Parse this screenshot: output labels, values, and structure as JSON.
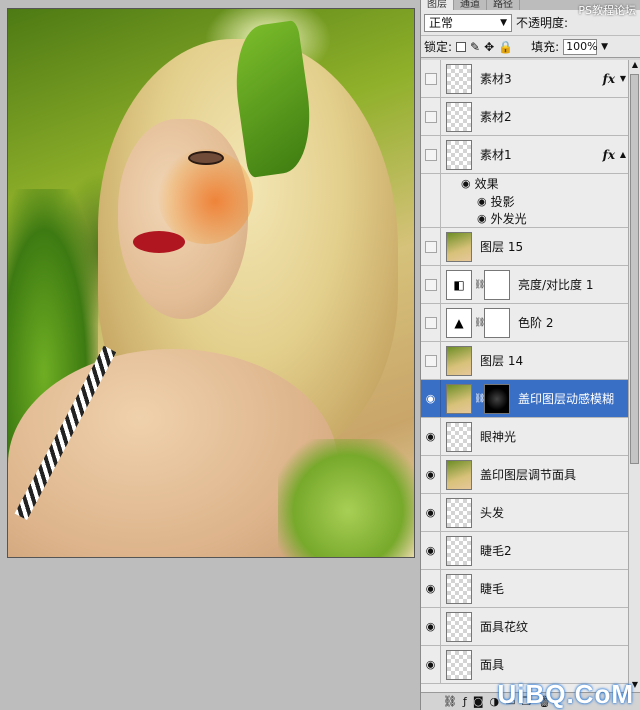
{
  "panel": {
    "tabs": [
      "图层",
      "通道",
      "路径"
    ],
    "watermark_top": "PS教程论坛",
    "blend_mode": "正常",
    "opacity_label": "不透明度:",
    "lock_label": "锁定:",
    "fill_label": "填充:",
    "fill_value": "100%"
  },
  "layers": [
    {
      "name": "素材3",
      "fx": "fx"
    },
    {
      "name": "素材2"
    },
    {
      "name": "素材1",
      "fx": "fx"
    },
    {
      "name": "亮度/对比度 1"
    },
    {
      "name": "色阶 2"
    },
    {
      "name": "图层 15"
    },
    {
      "name": "图层 14"
    },
    {
      "name": "盖印图层动感模糊"
    },
    {
      "name": "眼神光"
    },
    {
      "name": "盖印图层调节面具"
    },
    {
      "name": "头发"
    },
    {
      "name": "睫毛2"
    },
    {
      "name": "睫毛"
    },
    {
      "name": "面具花纹"
    },
    {
      "name": "面具"
    }
  ],
  "effects": {
    "label": "效果",
    "items": [
      "投影",
      "外发光"
    ]
  },
  "watermark_bottom": "UiBQ.CoM"
}
